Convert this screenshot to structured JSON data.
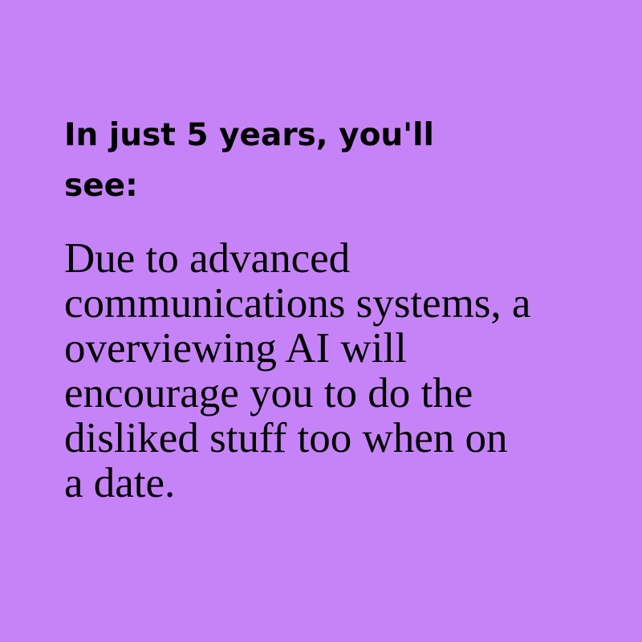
{
  "background_color": "#c683f7",
  "text_color": "#000000",
  "headline": "In just 5 years, you'll\nsee:",
  "body": "Due to advanced\ncommunications systems, a\noverviewing AI will\nencourage you to do the\ndisliked stuff too when on\na date."
}
